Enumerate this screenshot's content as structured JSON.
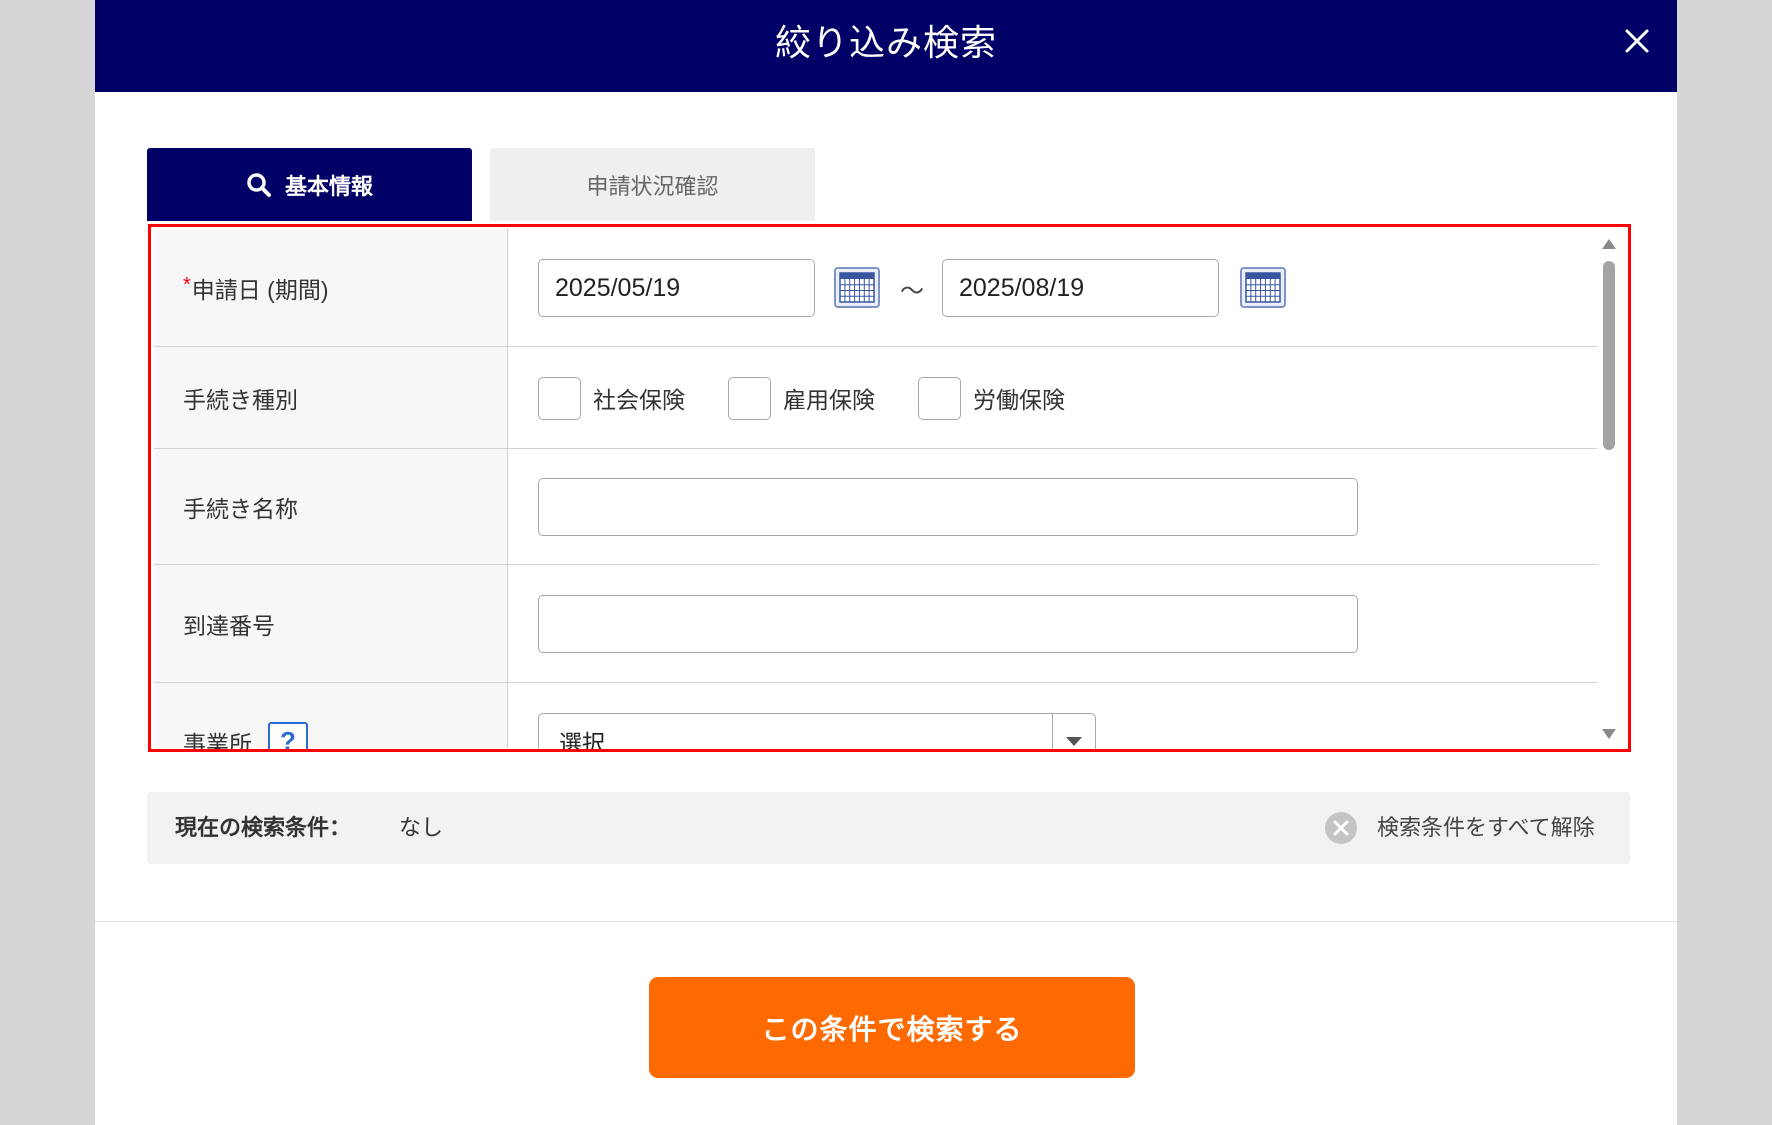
{
  "window": {
    "title": "絞り込み検索",
    "close_icon": "close-icon"
  },
  "tabs": [
    {
      "label": "基本情報",
      "icon": "search-icon",
      "active": true
    },
    {
      "label": "申請状況確認",
      "active": false
    }
  ],
  "form": {
    "application_date": {
      "required_mark": "*",
      "label": "申請日 (期間)",
      "from": "2025/05/19",
      "separator": "～",
      "to": "2025/08/19",
      "calendar_icon": "calendar-icon"
    },
    "procedure_type": {
      "label": "手続き種別",
      "options": [
        {
          "label": "社会保険",
          "checked": false
        },
        {
          "label": "雇用保険",
          "checked": false
        },
        {
          "label": "労働保険",
          "checked": false
        }
      ]
    },
    "procedure_name": {
      "label": "手続き名称",
      "value": ""
    },
    "arrival_number": {
      "label": "到達番号",
      "value": ""
    },
    "office": {
      "label": "事業所",
      "help_icon": "help-icon",
      "help_text": "?",
      "selected": "選択",
      "dropdown_icon": "chevron-down-icon"
    }
  },
  "current_conditions": {
    "label": "現在の検索条件：",
    "value": "なし",
    "clear_icon": "clear-icon",
    "clear_label": "検索条件をすべて解除"
  },
  "submit": {
    "label": "この条件で検索する"
  },
  "colors": {
    "header": "#000066",
    "active_tab": "#000066",
    "highlight_border": "#ff0000",
    "required": "#e60012",
    "submit": "#ff6a00"
  }
}
